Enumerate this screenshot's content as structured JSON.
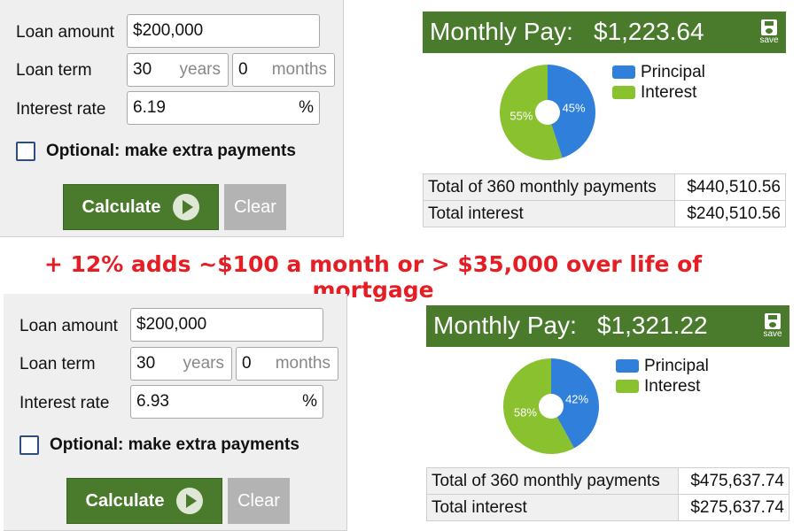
{
  "headline": "+ 12% adds ~$100 a month or > $35,000 over life of mortgage",
  "colors": {
    "accent": "#4a7a2c",
    "principal": "#2f7fdb",
    "interest": "#8ac12f",
    "headline": "#e51e25"
  },
  "calculators": [
    {
      "loan_amount_label": "Loan amount",
      "loan_amount": "$200,000",
      "loan_term_label": "Loan term",
      "term_years": "30",
      "years_unit": "years",
      "term_months": "0",
      "months_unit": "months",
      "rate_label": "Interest rate",
      "rate": "6.19",
      "rate_unit": "%",
      "extra_label": "Optional: make extra payments",
      "calculate_label": "Calculate",
      "clear_label": "Clear",
      "monthly_title": "Monthly Pay:",
      "monthly_amount": "$1,223.64",
      "save_label": "save",
      "legend": [
        "Principal",
        "Interest"
      ],
      "principal_pct": 45,
      "interest_pct": 55,
      "principal_label": "45%",
      "interest_label": "55%",
      "rows": [
        {
          "label": "Total of 360 monthly payments",
          "value": "$440,510.56"
        },
        {
          "label": "Total interest",
          "value": "$240,510.56"
        }
      ]
    },
    {
      "loan_amount_label": "Loan amount",
      "loan_amount": "$200,000",
      "loan_term_label": "Loan term",
      "term_years": "30",
      "years_unit": "years",
      "term_months": "0",
      "months_unit": "months",
      "rate_label": "Interest rate",
      "rate": "6.93",
      "rate_unit": "%",
      "extra_label": "Optional: make extra payments",
      "calculate_label": "Calculate",
      "clear_label": "Clear",
      "monthly_title": "Monthly Pay:",
      "monthly_amount": "$1,321.22",
      "save_label": "save",
      "legend": [
        "Principal",
        "Interest"
      ],
      "principal_pct": 42,
      "interest_pct": 58,
      "principal_label": "42%",
      "interest_label": "58%",
      "rows": [
        {
          "label": "Total of 360 monthly payments",
          "value": "$475,637.74"
        },
        {
          "label": "Total interest",
          "value": "$275,637.74"
        }
      ]
    }
  ]
}
